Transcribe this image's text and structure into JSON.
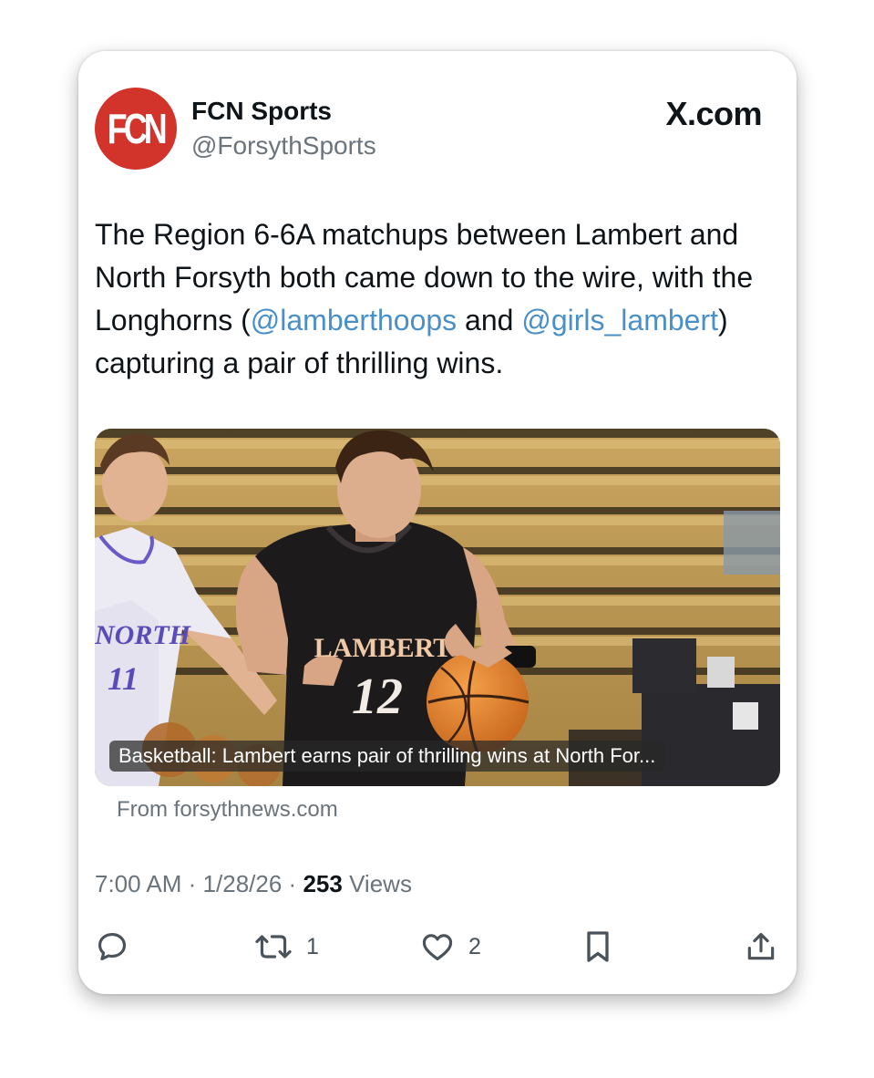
{
  "author": {
    "avatar_text": "FCN",
    "name": "FCN Sports",
    "handle": "@ForsythSports"
  },
  "platform": "X.com",
  "tweet": {
    "text_part1": "The Region 6-6A matchups between Lambert and North Forsyth both came down to the wire, with the Longhorns (",
    "mention1": "@lamberthoops",
    "text_part2": " and ",
    "mention2": "@girls_lambert",
    "text_part3": ") capturing a pair of thrilling wins."
  },
  "media": {
    "caption": "Basketball: Lambert earns pair of thrilling wins at North For...",
    "jersey_front_text": "LAMBERT",
    "jersey_front_number": "12",
    "jersey_side_text": "NORTH",
    "jersey_side_number": "11"
  },
  "source": "From forsythnews.com",
  "meta": {
    "time": "7:00 AM",
    "separator": "·",
    "date": "1/28/26",
    "views_count": "253",
    "views_label": "Views"
  },
  "actions": {
    "reply_icon": "reply-icon",
    "retweet_icon": "retweet-icon",
    "retweet_count": "1",
    "like_icon": "heart-icon",
    "like_count": "2",
    "bookmark_icon": "bookmark-icon",
    "share_icon": "share-icon"
  },
  "colors": {
    "mention": "#4a90c8",
    "avatar_bg": "#d2332b",
    "secondary_text": "#6b737b"
  }
}
